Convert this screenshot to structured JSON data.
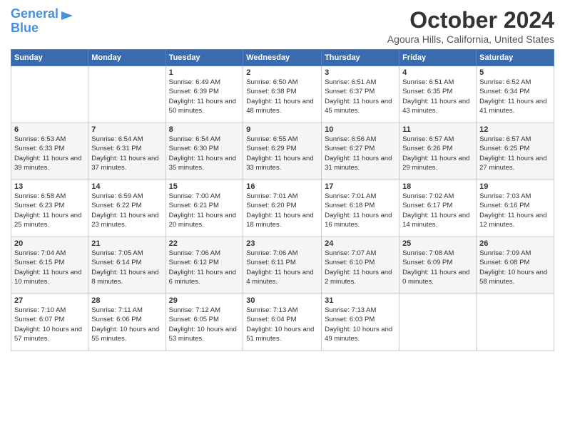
{
  "header": {
    "logo_line1": "General",
    "logo_line2": "Blue",
    "month": "October 2024",
    "location": "Agoura Hills, California, United States"
  },
  "days_of_week": [
    "Sunday",
    "Monday",
    "Tuesday",
    "Wednesday",
    "Thursday",
    "Friday",
    "Saturday"
  ],
  "weeks": [
    [
      {
        "day": "",
        "sunrise": "",
        "sunset": "",
        "daylight": ""
      },
      {
        "day": "",
        "sunrise": "",
        "sunset": "",
        "daylight": ""
      },
      {
        "day": "1",
        "sunrise": "Sunrise: 6:49 AM",
        "sunset": "Sunset: 6:39 PM",
        "daylight": "Daylight: 11 hours and 50 minutes."
      },
      {
        "day": "2",
        "sunrise": "Sunrise: 6:50 AM",
        "sunset": "Sunset: 6:38 PM",
        "daylight": "Daylight: 11 hours and 48 minutes."
      },
      {
        "day": "3",
        "sunrise": "Sunrise: 6:51 AM",
        "sunset": "Sunset: 6:37 PM",
        "daylight": "Daylight: 11 hours and 45 minutes."
      },
      {
        "day": "4",
        "sunrise": "Sunrise: 6:51 AM",
        "sunset": "Sunset: 6:35 PM",
        "daylight": "Daylight: 11 hours and 43 minutes."
      },
      {
        "day": "5",
        "sunrise": "Sunrise: 6:52 AM",
        "sunset": "Sunset: 6:34 PM",
        "daylight": "Daylight: 11 hours and 41 minutes."
      }
    ],
    [
      {
        "day": "6",
        "sunrise": "Sunrise: 6:53 AM",
        "sunset": "Sunset: 6:33 PM",
        "daylight": "Daylight: 11 hours and 39 minutes."
      },
      {
        "day": "7",
        "sunrise": "Sunrise: 6:54 AM",
        "sunset": "Sunset: 6:31 PM",
        "daylight": "Daylight: 11 hours and 37 minutes."
      },
      {
        "day": "8",
        "sunrise": "Sunrise: 6:54 AM",
        "sunset": "Sunset: 6:30 PM",
        "daylight": "Daylight: 11 hours and 35 minutes."
      },
      {
        "day": "9",
        "sunrise": "Sunrise: 6:55 AM",
        "sunset": "Sunset: 6:29 PM",
        "daylight": "Daylight: 11 hours and 33 minutes."
      },
      {
        "day": "10",
        "sunrise": "Sunrise: 6:56 AM",
        "sunset": "Sunset: 6:27 PM",
        "daylight": "Daylight: 11 hours and 31 minutes."
      },
      {
        "day": "11",
        "sunrise": "Sunrise: 6:57 AM",
        "sunset": "Sunset: 6:26 PM",
        "daylight": "Daylight: 11 hours and 29 minutes."
      },
      {
        "day": "12",
        "sunrise": "Sunrise: 6:57 AM",
        "sunset": "Sunset: 6:25 PM",
        "daylight": "Daylight: 11 hours and 27 minutes."
      }
    ],
    [
      {
        "day": "13",
        "sunrise": "Sunrise: 6:58 AM",
        "sunset": "Sunset: 6:23 PM",
        "daylight": "Daylight: 11 hours and 25 minutes."
      },
      {
        "day": "14",
        "sunrise": "Sunrise: 6:59 AM",
        "sunset": "Sunset: 6:22 PM",
        "daylight": "Daylight: 11 hours and 23 minutes."
      },
      {
        "day": "15",
        "sunrise": "Sunrise: 7:00 AM",
        "sunset": "Sunset: 6:21 PM",
        "daylight": "Daylight: 11 hours and 20 minutes."
      },
      {
        "day": "16",
        "sunrise": "Sunrise: 7:01 AM",
        "sunset": "Sunset: 6:20 PM",
        "daylight": "Daylight: 11 hours and 18 minutes."
      },
      {
        "day": "17",
        "sunrise": "Sunrise: 7:01 AM",
        "sunset": "Sunset: 6:18 PM",
        "daylight": "Daylight: 11 hours and 16 minutes."
      },
      {
        "day": "18",
        "sunrise": "Sunrise: 7:02 AM",
        "sunset": "Sunset: 6:17 PM",
        "daylight": "Daylight: 11 hours and 14 minutes."
      },
      {
        "day": "19",
        "sunrise": "Sunrise: 7:03 AM",
        "sunset": "Sunset: 6:16 PM",
        "daylight": "Daylight: 11 hours and 12 minutes."
      }
    ],
    [
      {
        "day": "20",
        "sunrise": "Sunrise: 7:04 AM",
        "sunset": "Sunset: 6:15 PM",
        "daylight": "Daylight: 11 hours and 10 minutes."
      },
      {
        "day": "21",
        "sunrise": "Sunrise: 7:05 AM",
        "sunset": "Sunset: 6:14 PM",
        "daylight": "Daylight: 11 hours and 8 minutes."
      },
      {
        "day": "22",
        "sunrise": "Sunrise: 7:06 AM",
        "sunset": "Sunset: 6:12 PM",
        "daylight": "Daylight: 11 hours and 6 minutes."
      },
      {
        "day": "23",
        "sunrise": "Sunrise: 7:06 AM",
        "sunset": "Sunset: 6:11 PM",
        "daylight": "Daylight: 11 hours and 4 minutes."
      },
      {
        "day": "24",
        "sunrise": "Sunrise: 7:07 AM",
        "sunset": "Sunset: 6:10 PM",
        "daylight": "Daylight: 11 hours and 2 minutes."
      },
      {
        "day": "25",
        "sunrise": "Sunrise: 7:08 AM",
        "sunset": "Sunset: 6:09 PM",
        "daylight": "Daylight: 11 hours and 0 minutes."
      },
      {
        "day": "26",
        "sunrise": "Sunrise: 7:09 AM",
        "sunset": "Sunset: 6:08 PM",
        "daylight": "Daylight: 10 hours and 58 minutes."
      }
    ],
    [
      {
        "day": "27",
        "sunrise": "Sunrise: 7:10 AM",
        "sunset": "Sunset: 6:07 PM",
        "daylight": "Daylight: 10 hours and 57 minutes."
      },
      {
        "day": "28",
        "sunrise": "Sunrise: 7:11 AM",
        "sunset": "Sunset: 6:06 PM",
        "daylight": "Daylight: 10 hours and 55 minutes."
      },
      {
        "day": "29",
        "sunrise": "Sunrise: 7:12 AM",
        "sunset": "Sunset: 6:05 PM",
        "daylight": "Daylight: 10 hours and 53 minutes."
      },
      {
        "day": "30",
        "sunrise": "Sunrise: 7:13 AM",
        "sunset": "Sunset: 6:04 PM",
        "daylight": "Daylight: 10 hours and 51 minutes."
      },
      {
        "day": "31",
        "sunrise": "Sunrise: 7:13 AM",
        "sunset": "Sunset: 6:03 PM",
        "daylight": "Daylight: 10 hours and 49 minutes."
      },
      {
        "day": "",
        "sunrise": "",
        "sunset": "",
        "daylight": ""
      },
      {
        "day": "",
        "sunrise": "",
        "sunset": "",
        "daylight": ""
      }
    ]
  ]
}
